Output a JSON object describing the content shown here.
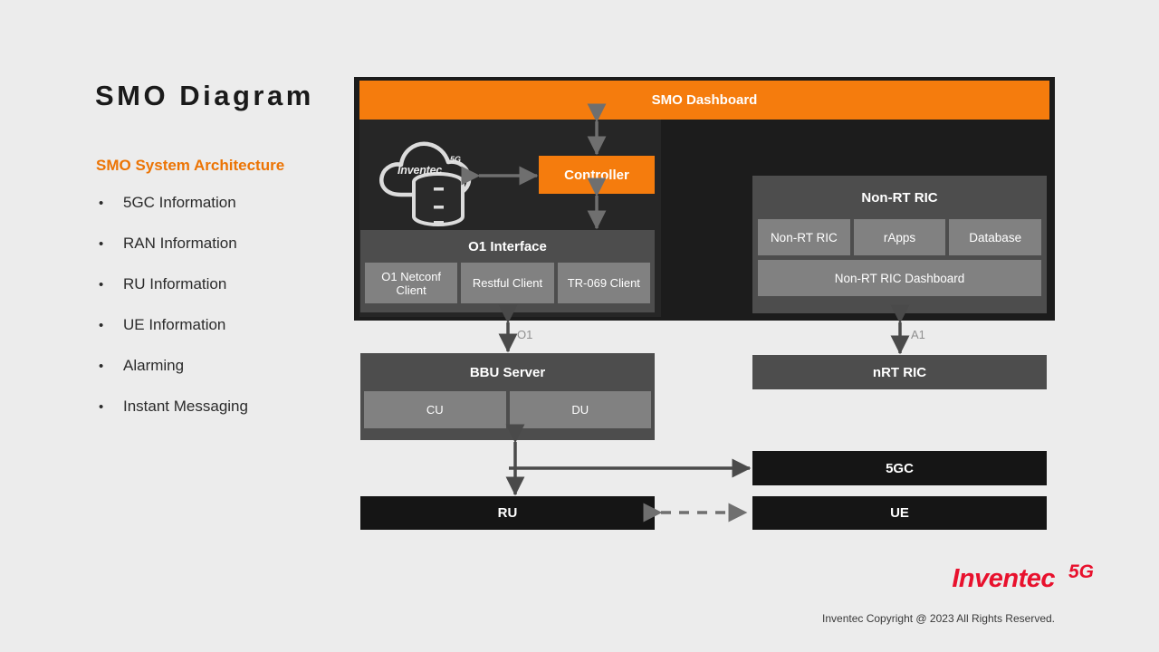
{
  "slide": {
    "title": "SMO Diagram",
    "subtitle": "SMO System Architecture",
    "bullet_marker": "•",
    "bullets": [
      {
        "label": "5GC Information"
      },
      {
        "label": "RAN Information"
      },
      {
        "label": "RU Information"
      },
      {
        "label": "UE Information"
      },
      {
        "label": "Alarming"
      },
      {
        "label": "Instant Messaging"
      }
    ]
  },
  "diagram": {
    "smo_dashboard": {
      "label": "SMO Dashboard"
    },
    "cloud": {
      "logo_text": "Inventec",
      "logo_suffix": "5G",
      "icon_name": "cloud-database-icon"
    },
    "controller": {
      "label": "Controller"
    },
    "o1_interface": {
      "title": "O1 Interface",
      "clients": [
        {
          "label": "O1 Netconf Client"
        },
        {
          "label": "Restful Client"
        },
        {
          "label": "TR-069 Client"
        }
      ]
    },
    "non_rt_ric": {
      "title": "Non-RT RIC",
      "items": [
        {
          "label": "Non-RT RIC"
        },
        {
          "label": "rApps"
        },
        {
          "label": "Database"
        }
      ],
      "dashboard": {
        "label": "Non-RT RIC Dashboard"
      }
    },
    "bbu_server": {
      "title": "BBU Server",
      "units": [
        {
          "label": "CU"
        },
        {
          "label": "DU"
        }
      ]
    },
    "nrt_ric": {
      "label": "nRT RIC"
    },
    "fivegc": {
      "label": "5GC"
    },
    "ru": {
      "label": "RU"
    },
    "ue": {
      "label": "UE"
    },
    "connectors": {
      "o1_label": "O1",
      "a1_label": "A1"
    }
  },
  "footer": {
    "logo_text": "Inventec",
    "logo_suffix": "5G",
    "copyright": "Inventec Copyright @ 2023 All Rights Reserved."
  },
  "colors": {
    "background": "#ececec",
    "accent_orange": "#f57c0d",
    "subtitle_orange": "#ec7404",
    "panel_black": "#1c1c1c",
    "box_dark_gray": "#4d4d4d",
    "box_light_gray": "#818181",
    "box_near_black": "#151515",
    "logo_red": "#e8112d",
    "connector_gray": "#5a5a5a"
  }
}
